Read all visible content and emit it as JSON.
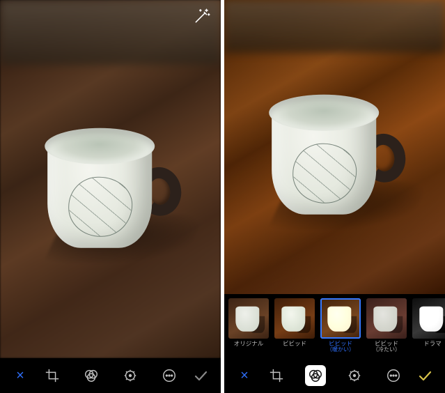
{
  "left": {
    "auto_enhance_icon": "magic-wand-icon",
    "toolbar": {
      "cancel_label": "×",
      "done_color": "#8a8a8a",
      "done_label": "✓"
    }
  },
  "right": {
    "filters": [
      {
        "id": "original",
        "label": "オリジナル",
        "sub": "",
        "variant": "orig",
        "selected": false
      },
      {
        "id": "vivid",
        "label": "ビビッド",
        "sub": "",
        "variant": "vivid",
        "selected": false
      },
      {
        "id": "vivid-warm",
        "label": "ビビッド",
        "sub": "（暖かい）",
        "variant": "warm",
        "selected": true
      },
      {
        "id": "vivid-cool",
        "label": "ビビッド",
        "sub": "（冷たい）",
        "variant": "cool",
        "selected": false
      },
      {
        "id": "dramatic",
        "label": "ドラマ",
        "sub": "",
        "variant": "mono",
        "selected": false
      }
    ],
    "toolbar": {
      "cancel_label": "×",
      "done_color": "#d8c24a",
      "done_label": "✓"
    }
  },
  "tool_icons": {
    "crop": "crop-icon",
    "filter": "filters-icon",
    "adjust": "adjust-dial-icon",
    "more": "more-ellipsis-icon"
  }
}
